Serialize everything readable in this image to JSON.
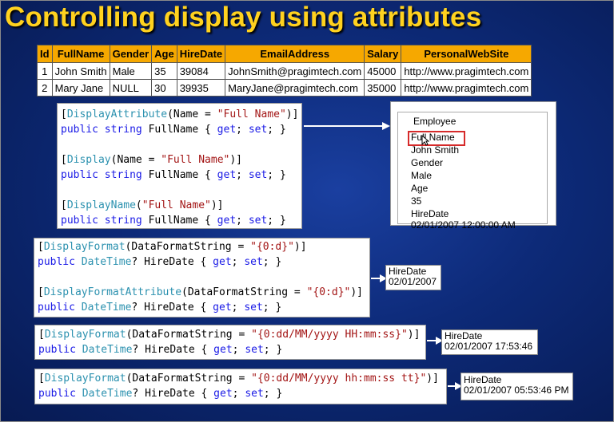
{
  "title": "Controlling display using attributes",
  "table": {
    "headers": [
      "Id",
      "FullName",
      "Gender",
      "Age",
      "HireDate",
      "EmailAddress",
      "Salary",
      "PersonalWebSite"
    ],
    "rows": [
      [
        "1",
        "John Smith",
        "Male",
        "35",
        "39084",
        "JohnSmith@pragimtech.com",
        "45000",
        "http://www.pragimtech.com"
      ],
      [
        "2",
        "Mary Jane",
        "NULL",
        "30",
        "39935",
        "MaryJane@pragimtech.com",
        "35000",
        "http://www.pragimtech.com"
      ]
    ]
  },
  "code": {
    "b1": {
      "l1a": "[",
      "l1b": "DisplayAttribute",
      "l1c": "(Name = ",
      "l1d": "\"Full Name\"",
      "l1e": ")]",
      "l2a": "public string",
      "l2b": " FullName { ",
      "l2c": "get",
      "l2d": "; ",
      "l2e": "set",
      "l2f": "; }",
      "l3a": "[",
      "l3b": "Display",
      "l3c": "(Name = ",
      "l3d": "\"Full Name\"",
      "l3e": ")]",
      "l4a": "public string",
      "l4b": " FullName { ",
      "l4c": "get",
      "l4d": "; ",
      "l4e": "set",
      "l4f": "; }",
      "l5a": "[",
      "l5b": "DisplayName",
      "l5c": "(",
      "l5d": "\"Full Name\"",
      "l5e": ")]",
      "l6a": "public string",
      "l6b": " FullName { ",
      "l6c": "get",
      "l6d": "; ",
      "l6e": "set",
      "l6f": "; }"
    },
    "b2": {
      "l1a": "[",
      "l1b": "DisplayFormat",
      "l1c": "(DataFormatString = ",
      "l1d": "\"{0:d}\"",
      "l1e": ")]",
      "l2a": "public",
      "l2b": " DateTime",
      "l2c": "? HireDate { ",
      "l2d": "get",
      "l2e": "; ",
      "l2f": "set",
      "l2g": "; }",
      "l3a": "[",
      "l3b": "DisplayFormatAttribute",
      "l3c": "(DataFormatString = ",
      "l3d": "\"{0:d}\"",
      "l3e": ")]",
      "l4a": "public",
      "l4b": " DateTime",
      "l4c": "? HireDate { ",
      "l4d": "get",
      "l4e": "; ",
      "l4f": "set",
      "l4g": "; }"
    },
    "b3": {
      "l1a": "[",
      "l1b": "DisplayFormat",
      "l1c": "(DataFormatString = ",
      "l1d": "\"{0:dd/MM/yyyy HH:mm:ss}\"",
      "l1e": ")]",
      "l2a": "public",
      "l2b": " DateTime",
      "l2c": "? HireDate { ",
      "l2d": "get",
      "l2e": "; ",
      "l2f": "set",
      "l2g": "; }"
    },
    "b4": {
      "l1a": "[",
      "l1b": "DisplayFormat",
      "l1c": "(DataFormatString = ",
      "l1d": "\"{0:dd/MM/yyyy hh:mm:ss tt}\"",
      "l1e": ")]",
      "l2a": "public",
      "l2b": " DateTime",
      "l2c": "? HireDate { ",
      "l2d": "get",
      "l2e": "; ",
      "l2f": "set",
      "l2g": "; }"
    }
  },
  "employee_box": {
    "legend": "Employee",
    "lines": [
      "Full Name",
      "John Smith",
      "Gender",
      "Male",
      "Age",
      "35",
      "HireDate",
      "02/01/2007 12:00:00 AM"
    ]
  },
  "outputs": {
    "o1": {
      "label": "HireDate",
      "value": "02/01/2007"
    },
    "o2": {
      "label": "HireDate",
      "value": "02/01/2007 17:53:46"
    },
    "o3": {
      "label": "HireDate",
      "value": "02/01/2007 05:53:46 PM"
    }
  }
}
